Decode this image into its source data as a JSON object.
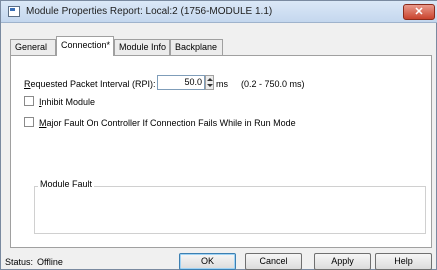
{
  "window": {
    "title": "Module Properties Report: Local:2 (1756-MODULE 1.1)",
    "close_glyph": "✕"
  },
  "tabs": [
    {
      "label": "General"
    },
    {
      "label": "Connection*"
    },
    {
      "label": "Module Info"
    },
    {
      "label": "Backplane"
    }
  ],
  "connection": {
    "rpi_label_mnemonic": "R",
    "rpi_label_rest": "equested Packet Interval (RPI):",
    "rpi_value": "50.0",
    "rpi_unit": "ms",
    "rpi_range": "(0.2 - 750.0 ms)",
    "inhibit_mnemonic": "I",
    "inhibit_rest": "nhibit Module",
    "inhibit_checked": false,
    "major_fault_mnemonic": "M",
    "major_fault_rest": "ajor Fault On Controller If Connection Fails While in Run Mode",
    "major_fault_checked": false,
    "module_fault_title": "Module Fault"
  },
  "status": {
    "label": "Status:",
    "value": "Offline"
  },
  "buttons": {
    "ok": "OK",
    "cancel": "Cancel",
    "apply": "Apply",
    "help": "Help"
  }
}
